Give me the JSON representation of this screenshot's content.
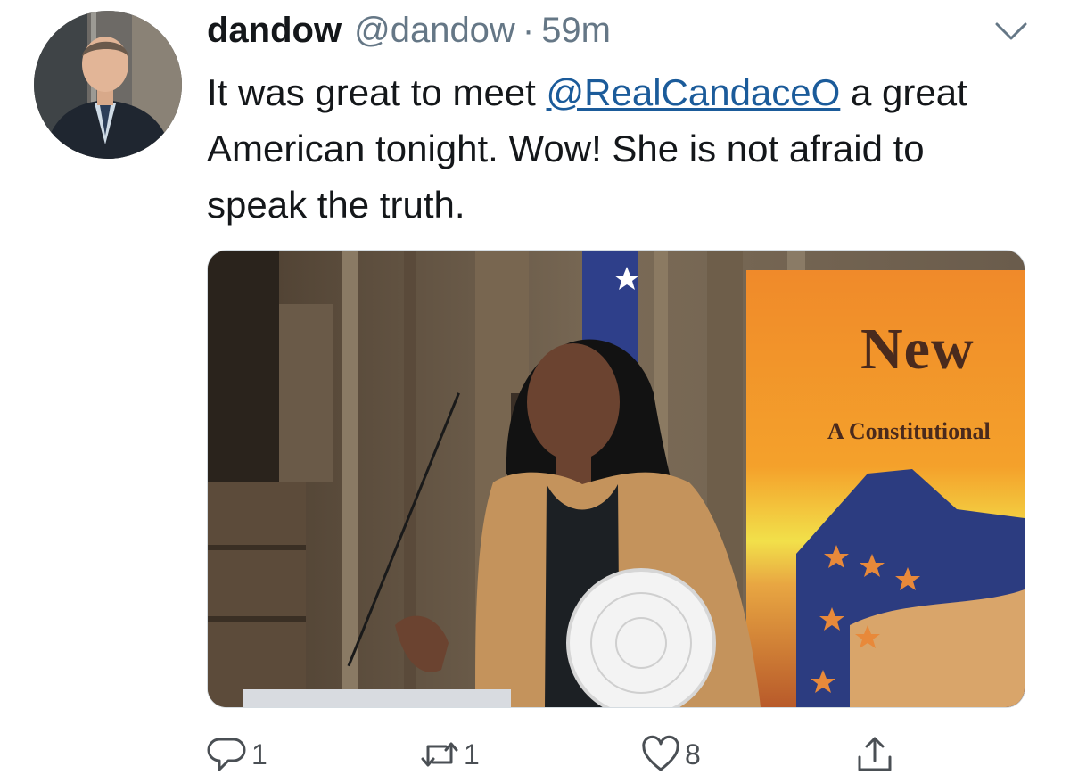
{
  "tweet": {
    "display_name": "dandow",
    "handle": "@dandow",
    "separator": "·",
    "time": "59m",
    "text_before": "It was great to meet ",
    "mention": "@RealCandaceO",
    "text_after": " a great American tonight. Wow! She is not afraid to speak the truth.",
    "menu_icon": "chevron-down-icon"
  },
  "media": {
    "banner_word": "New",
    "banner_subtitle": "A Constitutional"
  },
  "actions": {
    "reply": {
      "icon": "reply-icon",
      "count": "1"
    },
    "retweet": {
      "icon": "retweet-icon",
      "count": "1"
    },
    "like": {
      "icon": "heart-icon",
      "count": "8"
    },
    "share": {
      "icon": "share-icon"
    }
  },
  "colors": {
    "mention": "#1b5b9a",
    "secondary_text": "#657786",
    "icon": "#4a4f54"
  }
}
